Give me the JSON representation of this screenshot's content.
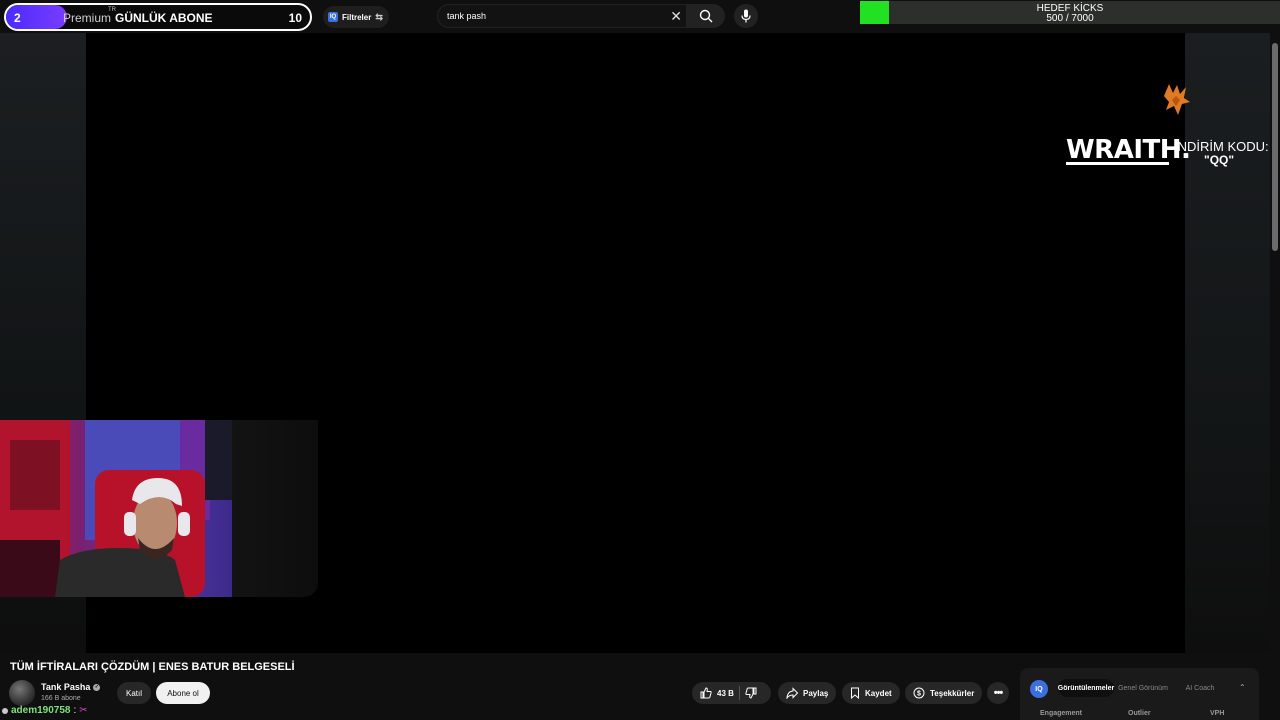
{
  "stream_overlay": {
    "sub_goal": {
      "current_left": "2",
      "premium_text": "Premium",
      "tm": "TR",
      "label": "GÜNLÜK ABONE",
      "target_right": "10",
      "progress": 0.2
    },
    "kick_goal": {
      "title": "HEDEF KİCKS",
      "count": "500 / 7000",
      "progress": 0.07
    },
    "sponsor": {
      "brand": "WRAITH.",
      "code_label": "İNDİRİM KODU:",
      "code_value": "\"QQ\""
    }
  },
  "header": {
    "filters_label": "Filtreler",
    "iq_badge": "IQ",
    "search": {
      "value": "tank pash"
    }
  },
  "video": {
    "title": "TÜM İFTİRALARI ÇÖZDÜM | ENES BATUR BELGESELİ",
    "channel": {
      "name": "Tank Pasha",
      "subscribers": "166 B abone"
    },
    "join_label": "Katıl",
    "subscribe_label": "Abone ol",
    "actions": {
      "likes": "43 B",
      "share": "Paylaş",
      "save": "Kaydet",
      "thanks": "Teşekkürler"
    }
  },
  "chat": {
    "user": "adem190758",
    "separator": ":"
  },
  "iq_panel": {
    "logo": "IQ",
    "tabs": [
      "Görüntülenmeler",
      "Genel Görünüm",
      "AI Coach"
    ],
    "columns": [
      "Engagement",
      "Outlier",
      "VPH"
    ]
  },
  "icons": [
    "filter-icon",
    "close-icon",
    "search-icon",
    "mic-icon",
    "like-icon",
    "dislike-icon",
    "share-icon",
    "bookmark-icon",
    "thanks-icon",
    "more-icon",
    "chevron-up-icon",
    "verified-icon",
    "wraith-logo-icon"
  ],
  "colors": {
    "sub_goal_fill": "#5a2fff",
    "kick_goal_fill": "#22e022",
    "iq_blue": "#3b6fe0",
    "chat_user": "#7fe07f"
  }
}
